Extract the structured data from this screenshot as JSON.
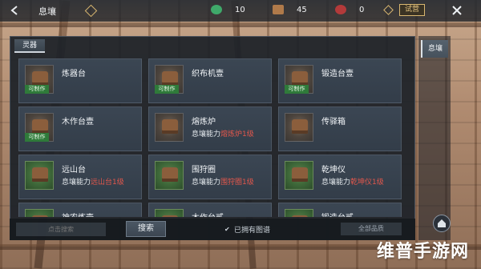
{
  "header": {
    "title": "息壤",
    "resources": [
      {
        "icon": "green-gem-icon",
        "value": "10",
        "color": "#3fa96a"
      },
      {
        "icon": "scroll-icon",
        "value": "45",
        "color": "#b07a4a"
      },
      {
        "icon": "red-seal-icon",
        "value": "0",
        "color": "#b33a3a"
      }
    ],
    "tag_label": "试营"
  },
  "panel": {
    "tab_label": "灵器",
    "items": [
      {
        "name": "炼器台",
        "requirement_prefix": "",
        "requirement_value": "",
        "craftable": true,
        "highlight": false
      },
      {
        "name": "织布机壹",
        "requirement_prefix": "",
        "requirement_value": "",
        "craftable": true,
        "highlight": false
      },
      {
        "name": "锻造台壹",
        "requirement_prefix": "",
        "requirement_value": "",
        "craftable": true,
        "highlight": false
      },
      {
        "name": "木作台壹",
        "requirement_prefix": "",
        "requirement_value": "",
        "craftable": true,
        "highlight": false
      },
      {
        "name": "熔炼炉",
        "requirement_prefix": "息壤能力",
        "requirement_value": "熔炼炉1级",
        "craftable": false,
        "highlight": false
      },
      {
        "name": "传驿箱",
        "requirement_prefix": "",
        "requirement_value": "",
        "craftable": false,
        "highlight": false
      },
      {
        "name": "远山台",
        "requirement_prefix": "息壤能力",
        "requirement_value": "远山台1级",
        "craftable": false,
        "highlight": true
      },
      {
        "name": "围狩圈",
        "requirement_prefix": "息壤能力",
        "requirement_value": "围狩圈1级",
        "craftable": false,
        "highlight": true
      },
      {
        "name": "乾坤仪",
        "requirement_prefix": "息壤能力",
        "requirement_value": "乾坤仪1级",
        "craftable": false,
        "highlight": true
      },
      {
        "name": "神农炼壶",
        "requirement_prefix": "",
        "requirement_value": "",
        "craftable": false,
        "highlight": false
      },
      {
        "name": "木作台贰",
        "requirement_prefix": "",
        "requirement_value": "",
        "craftable": false,
        "highlight": false
      },
      {
        "name": "锻造台贰",
        "requirement_prefix": "",
        "requirement_value": "",
        "craftable": false,
        "highlight": false
      }
    ],
    "craftable_label": "可制作"
  },
  "bottom": {
    "search_placeholder": "点击搜索",
    "search_button": "搜索",
    "owned_toggle": "已拥有图谱",
    "quality_select": "全部品质"
  },
  "side": {
    "tab_label": "息壤"
  },
  "watermark": "维普手游网"
}
